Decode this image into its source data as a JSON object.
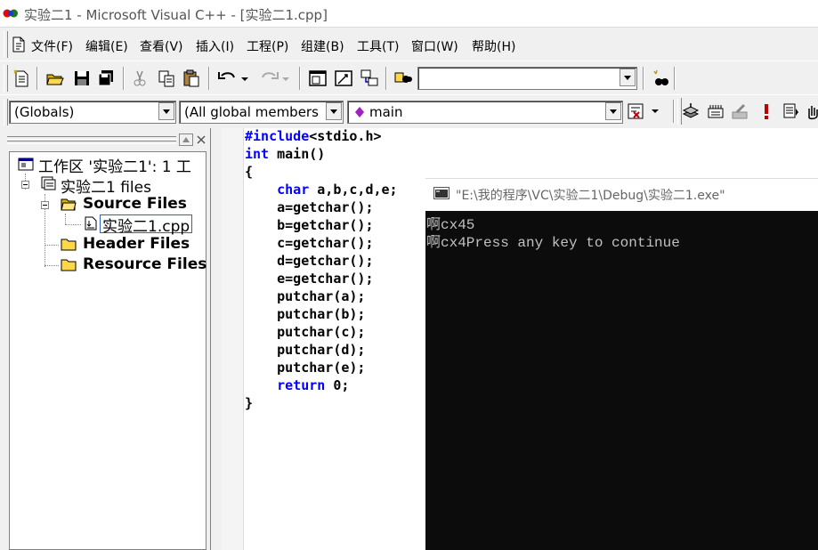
{
  "window": {
    "title": "实验二1 - Microsoft Visual C++ - [实验二1.cpp]"
  },
  "menu": [
    {
      "label": "文件(F)"
    },
    {
      "label": "编辑(E)"
    },
    {
      "label": "查看(V)"
    },
    {
      "label": "插入(I)"
    },
    {
      "label": "工程(P)"
    },
    {
      "label": "组建(B)"
    },
    {
      "label": "工具(T)"
    },
    {
      "label": "窗口(W)"
    },
    {
      "label": "帮助(H)"
    }
  ],
  "toolbar": {
    "find_combo_value": ""
  },
  "wizardbar": {
    "class_combo": "(Globals)",
    "filter_combo": "(All global members",
    "member_combo": "main"
  },
  "workspace": {
    "root": "工作区 '实验二1': 1 工",
    "project": "实验二1 files",
    "source_folder": "Source Files",
    "source_file": "实验二1.cpp",
    "header_folder": "Header Files",
    "resource_folder": "Resource Files"
  },
  "code": [
    {
      "kw": "#include",
      "rest": "<stdio.h>"
    },
    {
      "kw": "int",
      "rest": " main()"
    },
    {
      "kw": "",
      "rest": "{"
    },
    {
      "kw": "    char",
      "rest": " a,b,c,d,e;"
    },
    {
      "kw": "",
      "rest": "    a=getchar();"
    },
    {
      "kw": "",
      "rest": "    b=getchar();"
    },
    {
      "kw": "",
      "rest": "    c=getchar();"
    },
    {
      "kw": "",
      "rest": "    d=getchar();"
    },
    {
      "kw": "",
      "rest": "    e=getchar();"
    },
    {
      "kw": "",
      "rest": "    putchar(a);"
    },
    {
      "kw": "",
      "rest": "    putchar(b);"
    },
    {
      "kw": "",
      "rest": "    putchar(c);"
    },
    {
      "kw": "",
      "rest": "    putchar(d);"
    },
    {
      "kw": "",
      "rest": "    putchar(e);"
    },
    {
      "kw": "    return",
      "rest": " 0;"
    },
    {
      "kw": "",
      "rest": "}"
    }
  ],
  "console": {
    "title": "\"E:\\我的程序\\VC\\实验二1\\Debug\\实验二1.exe\"",
    "lines": [
      "啊cx45",
      "啊cx4Press any key to continue"
    ]
  },
  "colors": {
    "keyword": "#0000ff",
    "console_bg": "#0c0c0c",
    "console_text": "#c0c0c0",
    "chrome": "#f0f0f0"
  }
}
